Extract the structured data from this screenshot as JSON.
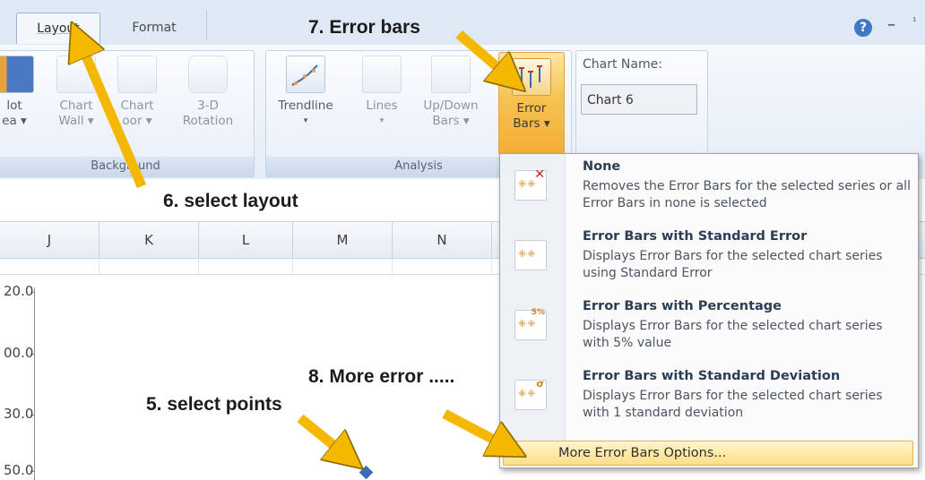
{
  "tabs": {
    "layout": "Layout",
    "format": "Format"
  },
  "window": {
    "help": "?",
    "minimize": "–",
    "edge": "¹"
  },
  "ribbon": {
    "background_group": {
      "label": "Background",
      "plot_area": {
        "line1": "lot",
        "line2": "ea ▾"
      },
      "chart_wall": {
        "line1": "Chart",
        "line2": "Wall ▾"
      },
      "chart_floor": {
        "line1": "Chart",
        "line2": "oor ▾"
      },
      "rotation": {
        "line1": "3-D",
        "line2": "Rotation"
      }
    },
    "analysis_group": {
      "label": "Analysis",
      "trendline": {
        "line1": "Trendline",
        "line2": "▾"
      },
      "lines": {
        "line1": "Lines",
        "line2": "▾"
      },
      "updown": {
        "line1": "Up/Down",
        "line2": "Bars ▾"
      },
      "error_bars": {
        "line1": "Error",
        "line2": "Bars ▾"
      }
    },
    "properties": {
      "chart_name_label": "Chart Name:",
      "chart_name_value": "Chart 6"
    }
  },
  "columns": [
    "J",
    "K",
    "L",
    "M",
    "N"
  ],
  "chart": {
    "y_labels": [
      "20.0",
      "00.0",
      "30.0",
      "50.0"
    ]
  },
  "annotations": {
    "step7": "7. Error bars",
    "step6": "6. select layout",
    "step8": "8. More error .....",
    "step5": "5. select points"
  },
  "menu": {
    "items": [
      {
        "title": "None",
        "desc": "Removes the Error Bars for the selected series or all Error Bars in none is selected",
        "icon": "error-bars-none-icon"
      },
      {
        "title": "Error Bars with Standard Error",
        "desc": "Displays Error Bars for the selected chart series using Standard Error",
        "icon": "error-bars-standard-error-icon"
      },
      {
        "title": "Error Bars with Percentage",
        "desc": "Displays Error Bars for the selected chart series with 5% value",
        "icon": "error-bars-percentage-icon"
      },
      {
        "title": "Error Bars with Standard Deviation",
        "desc": "Displays Error Bars for the selected chart series with 1 standard deviation",
        "icon": "error-bars-standard-deviation-icon"
      }
    ],
    "more": "More Error Bars Options..."
  },
  "colors": {
    "arrow": "#f5b800",
    "highlight": "#f6c250",
    "point": "#3c6cb3"
  }
}
